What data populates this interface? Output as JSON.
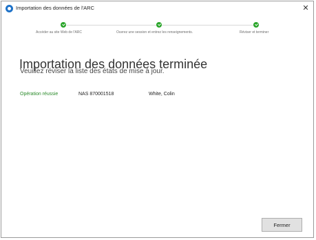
{
  "window": {
    "title": "Importation des données de l'ARC",
    "close_glyph": "✕"
  },
  "steps": [
    {
      "label": "Accéder au site Web de l'ARC",
      "status": "complete"
    },
    {
      "label": "Ouvrez une session et entrez les renseignements.",
      "status": "complete"
    },
    {
      "label": "Réviser et terminer",
      "status": "complete"
    }
  ],
  "main": {
    "heading": "Importation des données terminée",
    "subheading": "Veuillez réviser la liste des états de mise à jour.",
    "results": [
      {
        "status": "Opération réussie",
        "nas": "NAS  870001518",
        "name": "White, Colin"
      }
    ]
  },
  "footer": {
    "close_label": "Fermer"
  },
  "colors": {
    "success": "#2a8a2a",
    "step_complete": "#2aa52a",
    "app_icon": "#1e72c8"
  },
  "icons": {
    "app": "app-icon",
    "step": "check-circle-icon",
    "close": "close-icon"
  }
}
